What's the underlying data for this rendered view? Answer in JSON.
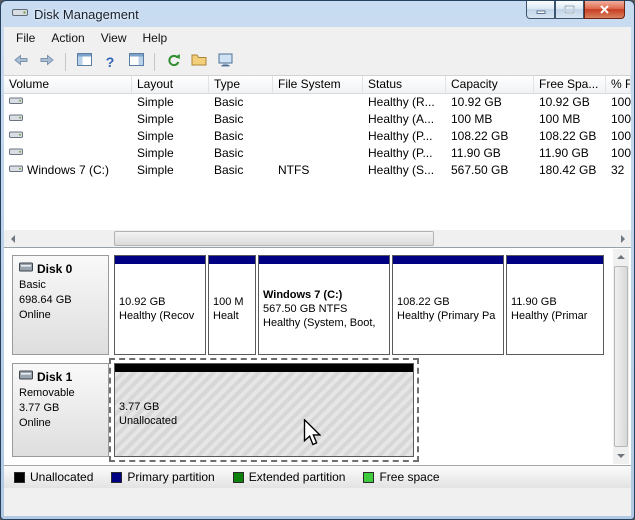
{
  "window": {
    "title": "Disk Management"
  },
  "menu": {
    "items": [
      "File",
      "Action",
      "View",
      "Help"
    ]
  },
  "toolbar": {
    "icons": [
      "back",
      "forward",
      "show-console-tree",
      "help",
      "show-action-pane",
      "refresh",
      "export-list",
      "console-window"
    ]
  },
  "volume_list": {
    "columns": [
      "Volume",
      "Layout",
      "Type",
      "File System",
      "Status",
      "Capacity",
      "Free Spa...",
      "% F"
    ],
    "rows": [
      {
        "volume": "",
        "layout": "Simple",
        "type": "Basic",
        "file_system": "",
        "status": "Healthy (R...",
        "capacity": "10.92 GB",
        "free_space": "10.92 GB",
        "pct_free": "100"
      },
      {
        "volume": "",
        "layout": "Simple",
        "type": "Basic",
        "file_system": "",
        "status": "Healthy (A...",
        "capacity": "100 MB",
        "free_space": "100 MB",
        "pct_free": "100"
      },
      {
        "volume": "",
        "layout": "Simple",
        "type": "Basic",
        "file_system": "",
        "status": "Healthy (P...",
        "capacity": "108.22 GB",
        "free_space": "108.22 GB",
        "pct_free": "100"
      },
      {
        "volume": "",
        "layout": "Simple",
        "type": "Basic",
        "file_system": "",
        "status": "Healthy (P...",
        "capacity": "11.90 GB",
        "free_space": "11.90 GB",
        "pct_free": "100"
      },
      {
        "volume": "Windows 7 (C:)",
        "layout": "Simple",
        "type": "Basic",
        "file_system": "NTFS",
        "status": "Healthy (S...",
        "capacity": "567.50 GB",
        "free_space": "180.42 GB",
        "pct_free": "32"
      }
    ]
  },
  "disks": [
    {
      "name": "Disk 0",
      "attrs": [
        "Basic",
        "698.64 GB",
        "Online"
      ],
      "partitions": [
        {
          "bar": "#000082",
          "lines": [
            "10.92 GB",
            "Healthy (Recov"
          ]
        },
        {
          "bar": "#000082",
          "lines": [
            "100 M",
            "Healt"
          ]
        },
        {
          "bar": "#000082",
          "lines": [
            "Windows 7  (C:)",
            "567.50 GB NTFS",
            "Healthy (System, Boot,"
          ]
        },
        {
          "bar": "#000082",
          "lines": [
            "108.22 GB",
            "Healthy (Primary Pa"
          ]
        },
        {
          "bar": "#000082",
          "lines": [
            "11.90 GB",
            "Healthy (Primar"
          ]
        }
      ]
    },
    {
      "name": "Disk 1",
      "attrs": [
        "Removable",
        "3.77 GB",
        "Online"
      ],
      "partitions": [
        {
          "bar": "#000000",
          "lines": [
            "3.77 GB",
            "Unallocated"
          ]
        }
      ]
    }
  ],
  "legend": {
    "items": [
      {
        "label": "Unallocated",
        "color": "#000000"
      },
      {
        "label": "Primary partition",
        "color": "#000082"
      },
      {
        "label": "Extended partition",
        "color": "#0b800b"
      },
      {
        "label": "Free space",
        "color": "#3ecc3e"
      }
    ]
  }
}
